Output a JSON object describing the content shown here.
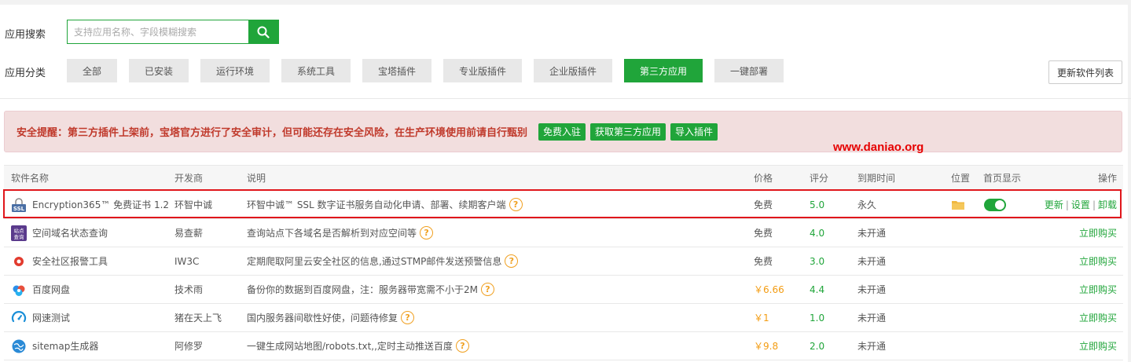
{
  "search": {
    "label": "应用搜索",
    "placeholder": "支持应用名称、字段模糊搜索",
    "value": ""
  },
  "categories": {
    "label": "应用分类",
    "items": [
      "全部",
      "已安装",
      "运行环境",
      "系统工具",
      "宝塔插件",
      "专业版插件",
      "企业版插件",
      "第三方应用",
      "一键部署"
    ],
    "active": "第三方应用"
  },
  "update_button": "更新软件列表",
  "alert": {
    "text": "安全提醒：第三方插件上架前，宝塔官方进行了安全审计，但可能还存在安全风险，在生产环境使用前请自行甄别",
    "buttons": [
      "免费入驻",
      "获取第三方应用",
      "导入插件"
    ]
  },
  "watermark": "www.daniao.org",
  "table": {
    "headers": {
      "name": "软件名称",
      "dev": "开发商",
      "desc": "说明",
      "price": "价格",
      "score": "评分",
      "expire": "到期时间",
      "pos": "位置",
      "home": "首页显示",
      "op": "操作"
    },
    "rows": [
      {
        "name": "Encryption365™ 免费证书 1.2",
        "dev": "环智中诚",
        "desc": "环智中诚™ SSL 数字证书服务自动化申请、部署、续期客户端",
        "price": "免费",
        "score": "5.0",
        "expire": "永久",
        "icon": "ssl-icon",
        "ops": [
          "更新",
          "设置",
          "卸载"
        ]
      },
      {
        "name": "空间域名状态查询",
        "dev": "易查薪",
        "desc": "查询站点下各域名是否解析到对应空间等",
        "price": "免费",
        "score": "4.0",
        "expire": "未开通",
        "icon": "domain-query-icon",
        "ops": [
          "立即购买"
        ]
      },
      {
        "name": "安全社区报警工具",
        "dev": "IW3C",
        "desc": "定期爬取阿里云安全社区的信息,通过STMP邮件发送预警信息",
        "price": "免费",
        "score": "3.0",
        "expire": "未开通",
        "icon": "alarm-icon",
        "ops": [
          "立即购买"
        ]
      },
      {
        "name": "百度网盘",
        "dev": "技术雨",
        "desc": "备份你的数据到百度网盘，注：服务器带宽需不小于2M",
        "price": "￥6.66",
        "score": "4.4",
        "expire": "未开通",
        "icon": "baidu-pan-icon",
        "ops": [
          "立即购买"
        ]
      },
      {
        "name": "网速测试",
        "dev": "猪在天上飞",
        "desc": "国内服务器间歇性好使，问题待修复",
        "price": "￥1",
        "score": "1.0",
        "expire": "未开通",
        "icon": "speedtest-icon",
        "ops": [
          "立即购买"
        ]
      },
      {
        "name": "sitemap生成器",
        "dev": "阿修罗",
        "desc": "一键生成网站地图/robots.txt,,定时主动推送百度",
        "price": "￥9.8",
        "score": "2.0",
        "expire": "未开通",
        "icon": "sitemap-icon",
        "ops": [
          "立即购买"
        ]
      }
    ]
  },
  "colors": {
    "accent": "#20a53a",
    "alert_bg": "#f2dede",
    "alert_text": "#c0392b",
    "paid_price": "#f39c12",
    "highlight_border": "#e0161b"
  }
}
